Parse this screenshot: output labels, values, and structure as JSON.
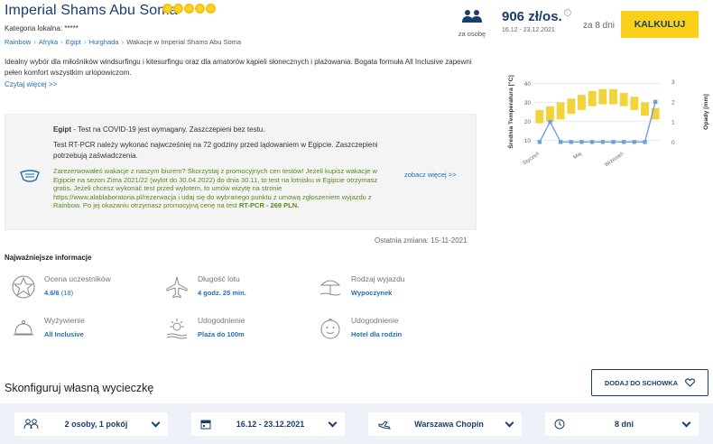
{
  "header": {
    "title": "Imperial Shams Abu Soma",
    "stars": 5,
    "category": "Kategoria lokalna: *****",
    "breadcrumb": [
      "Rainbow",
      "Afryka",
      "Egipt",
      "Hurghada",
      "Wakacje w Imperial Shams Abu Soma"
    ]
  },
  "pricing": {
    "per_person_label": "za osobę",
    "price": "906 zł/os.",
    "dates": "16.12 - 23.12.2021",
    "days": "za 8 dni",
    "calc_button": "KALKULUJ",
    "info_glyph": "i"
  },
  "description": {
    "text": "Idealny wybór dla miłośników windsurfingu i kitesurfingu oraz dla amatorów kąpieli słonecznych i plażowania. Bogata formuła All Inclusive zapewni pełen komfort wszystkim urlopowiczom.",
    "read_more": "Czytaj więcej >>"
  },
  "covid": {
    "country": "Egipt",
    "line1": " - Test na COVID-19 jest wymagany. Zaszczepieni bez testu.",
    "line2": "Test RT-PCR należy wykonać najwcześniej na 72 godziny przed lądowaniem w Egipcie. Zaszczepieni potrzebują zaświadczenia.",
    "promo": "Zarezerwowałeś wakacje z naszym biurem? Skorzystaj z promocyjnych cen testów! Jeżeli kupisz wakacje w Egipcie na sezon Zima 2021/22 (wylot do 30.04.2022) do dnia 30.11, to test na lotnisku w Egipcie otrzymasz gratis. Jeżeli chcesz wykonać test przed wylotem, to umów wizytę na stronie https://www.alablaboratoria.pl/rezerwacja i udaj się do wybranego punktu z umową zgłoszeniem wyjazdu z Rainbow. Po jej okazaniu otrzymasz promocyjną cenę na test ",
    "promo_bold": "RT-PCR - 269 PLN.",
    "see_more": "zobacz więcej >>",
    "last_change": "Ostatnia zmiana: 15-11-2021",
    "icon": "mask-icon"
  },
  "key_info": {
    "title": "Najważniejsze informacje",
    "items": [
      {
        "label": "Ocena uczestników",
        "value": "4.6/6",
        "extra": " (18)",
        "icon": "rating-star-icon"
      },
      {
        "label": "Długość lotu",
        "value": "4 godz. 25 min.",
        "icon": "airplane-icon"
      },
      {
        "label": "Rodzaj wyjazdu",
        "value": "Wypoczynek",
        "icon": "beach-umbrella-icon"
      },
      {
        "label": "Wyżywienie",
        "value": "All Inclusive",
        "icon": "food-cloche-icon"
      },
      {
        "label": "Udogodnienie",
        "value": "Plaża do 100m",
        "icon": "sun-beach-icon"
      },
      {
        "label": "Udogodnienie",
        "value": "Hotel dla rodzin",
        "icon": "child-face-icon"
      }
    ]
  },
  "configure": {
    "title": "Skonfiguruj własną wycieczkę",
    "dodaj_button": "DODAJ DO SCHOWKA",
    "fields": [
      {
        "value": "2 osoby, 1 pokój",
        "icon": "people-icon"
      },
      {
        "value": "16.12 - 23.12.2021",
        "icon": "calendar-icon"
      },
      {
        "value": "Warszawa Chopin",
        "icon": "plane-departure-icon"
      },
      {
        "value": "8 dni",
        "icon": "clock-icon"
      }
    ]
  },
  "chart_data": {
    "type": "bar+line",
    "ylabel_left": "Średnia Temperatura [°C]",
    "ylabel_right": "Opady [mm]",
    "y_left_ticks": [
      10,
      20,
      30,
      40
    ],
    "y_right_ticks": [
      0,
      1,
      2,
      3
    ],
    "ylim_left": [
      6,
      44
    ],
    "ylim_right": [
      -0.3,
      3.3
    ],
    "x_tick_labels": [
      "Styczeń",
      "Maj",
      "Wrzesień"
    ],
    "x_tick_label_months": [
      0,
      4,
      8
    ],
    "months": 12,
    "temp_ranges": [
      [
        19,
        26
      ],
      [
        20,
        28
      ],
      [
        21,
        30
      ],
      [
        24,
        32
      ],
      [
        26,
        34
      ],
      [
        28,
        36
      ],
      [
        29,
        37
      ],
      [
        29,
        37
      ],
      [
        28,
        35
      ],
      [
        26,
        33
      ],
      [
        23,
        30
      ],
      [
        21,
        27
      ]
    ],
    "rainfall": [
      0,
      1,
      0,
      0,
      0,
      0,
      0,
      0,
      0,
      0,
      0,
      2
    ],
    "bar_color": "#f2d43a",
    "line_color": "#6ca0dc"
  },
  "colors": {
    "brand_navy": "#1a3d6d",
    "link_blue": "#1f6fb5",
    "accent_yellow": "#fbd01a",
    "promo_green": "#5a8a1a"
  }
}
